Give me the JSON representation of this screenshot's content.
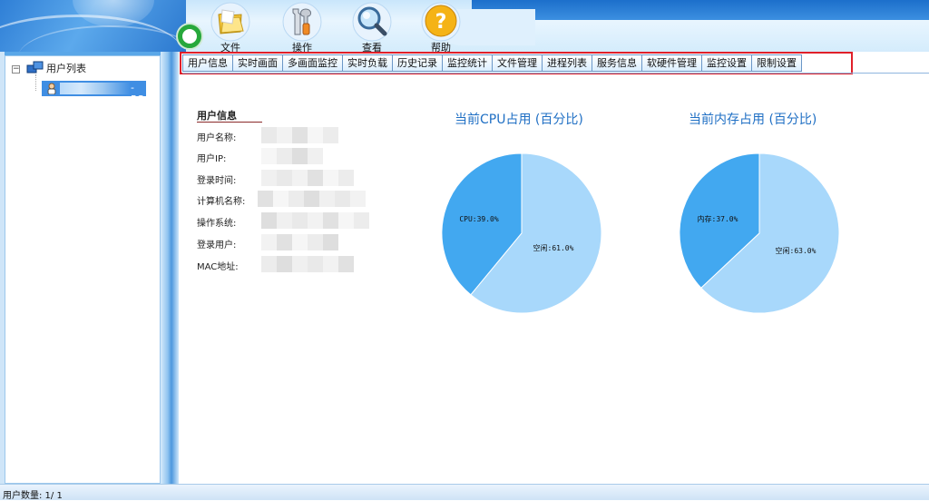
{
  "toolbar": {
    "items": [
      {
        "label": "文件",
        "icon": "folder-icon"
      },
      {
        "label": "操作",
        "icon": "tools-icon"
      },
      {
        "label": "查看",
        "icon": "magnifier-icon"
      },
      {
        "label": "帮助",
        "icon": "help-icon"
      }
    ],
    "reload_icon": "green-circle-refresh-icon"
  },
  "tree": {
    "root_label": "用户列表",
    "selected_user_suffix": "-PC"
  },
  "tabs": [
    "用户信息",
    "实时画面",
    "多画面监控",
    "实时负载",
    "历史记录",
    "监控统计",
    "文件管理",
    "进程列表",
    "服务信息",
    "软硬件管理",
    "监控设置",
    "限制设置"
  ],
  "user_info": {
    "title": "用户信息",
    "labels": [
      "用户名称:",
      "用户IP:",
      "登录时间:",
      "计算机名称:",
      "操作系统:",
      "登录用户:",
      "MAC地址:"
    ]
  },
  "chart_data": [
    {
      "type": "pie",
      "title": "当前CPU占用 (百分比)",
      "slices": [
        {
          "label": "CPU:39.0%",
          "value": 39.0,
          "color": "#42a8f0"
        },
        {
          "label": "空闲:61.0%",
          "value": 61.0,
          "color": "#a8d8fb"
        }
      ]
    },
    {
      "type": "pie",
      "title": "当前内存占用 (百分比)",
      "slices": [
        {
          "label": "内存:37.0%",
          "value": 37.0,
          "color": "#42a8f0"
        },
        {
          "label": "空闲:63.0%",
          "value": 63.0,
          "color": "#a8d8fb"
        }
      ]
    }
  ],
  "status": {
    "text": "用户数量:  1/ 1"
  }
}
